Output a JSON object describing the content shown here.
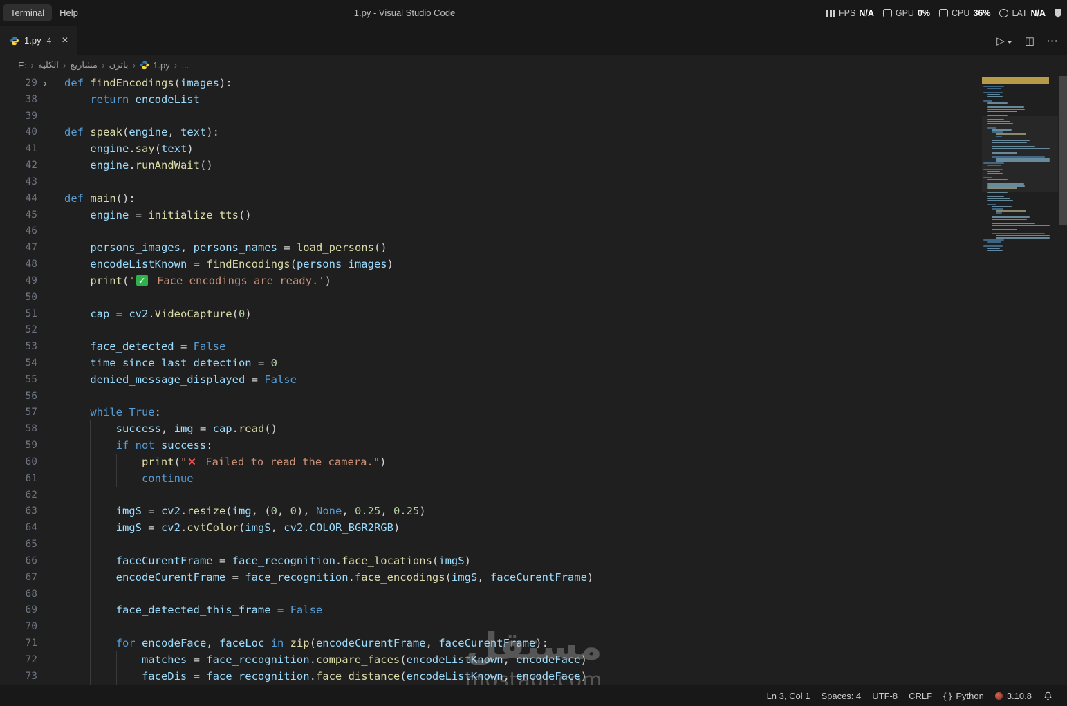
{
  "title_bar": {
    "menus": [
      {
        "label": "Terminal",
        "active": true
      },
      {
        "label": "Help",
        "active": false
      }
    ],
    "window_title": "1.py - Visual Studio Code",
    "perf_overlay": {
      "groups": [
        {
          "icon": "fps",
          "label": "FPS",
          "value": "N/A"
        },
        {
          "icon": "gpu",
          "label": "GPU",
          "value": "0%"
        },
        {
          "icon": "cpu",
          "label": "CPU",
          "value": "36%"
        },
        {
          "icon": "lat",
          "label": "LAT",
          "value": "N/A"
        }
      ]
    }
  },
  "tab_bar": {
    "tabs": [
      {
        "label": "1.py",
        "badge": "4"
      }
    ]
  },
  "breadcrumb": {
    "items": [
      {
        "label": "E:"
      },
      {
        "label": "الكليه"
      },
      {
        "label": "مشاريع"
      },
      {
        "label": "باترن"
      },
      {
        "label": "1.py",
        "icon": "python"
      },
      {
        "label": "..."
      }
    ]
  },
  "icons": {
    "close": "×",
    "chevron": "›",
    "fold_chevron": "›",
    "run": "▷",
    "split": "◫",
    "more": "···",
    "braces": "{ }"
  },
  "editor": {
    "token_colors": {
      "kw": "#569cd6",
      "fn": "#dcdcaa",
      "var": "#9cdcfe",
      "pn": "#d4d4d4",
      "op": "#d4d4d4",
      "str": "#ce9178",
      "num": "#b5cea8"
    },
    "lines": [
      {
        "n": 29,
        "ind": 0,
        "fold": true,
        "t": [
          [
            "kw",
            "def "
          ],
          [
            "fn",
            "findEncodings"
          ],
          [
            "pn",
            "("
          ],
          [
            "var",
            "images"
          ],
          [
            "pn",
            "):"
          ]
        ]
      },
      {
        "n": 38,
        "ind": 1,
        "t": [
          [
            "kw",
            "return "
          ],
          [
            "var",
            "encodeList"
          ]
        ]
      },
      {
        "n": 39,
        "ind": 0,
        "t": []
      },
      {
        "n": 40,
        "ind": 0,
        "t": [
          [
            "kw",
            "def "
          ],
          [
            "fn",
            "speak"
          ],
          [
            "pn",
            "("
          ],
          [
            "var",
            "engine"
          ],
          [
            "pn",
            ", "
          ],
          [
            "var",
            "text"
          ],
          [
            "pn",
            "):"
          ]
        ]
      },
      {
        "n": 41,
        "ind": 1,
        "t": [
          [
            "var",
            "engine"
          ],
          [
            "pn",
            "."
          ],
          [
            "fn",
            "say"
          ],
          [
            "pn",
            "("
          ],
          [
            "var",
            "text"
          ],
          [
            "pn",
            ")"
          ]
        ]
      },
      {
        "n": 42,
        "ind": 1,
        "t": [
          [
            "var",
            "engine"
          ],
          [
            "pn",
            "."
          ],
          [
            "fn",
            "runAndWait"
          ],
          [
            "pn",
            "()"
          ]
        ]
      },
      {
        "n": 43,
        "ind": 0,
        "t": []
      },
      {
        "n": 44,
        "ind": 0,
        "t": [
          [
            "kw",
            "def "
          ],
          [
            "fn",
            "main"
          ],
          [
            "pn",
            "():"
          ]
        ]
      },
      {
        "n": 45,
        "ind": 1,
        "t": [
          [
            "var",
            "engine"
          ],
          [
            "op",
            " = "
          ],
          [
            "fn",
            "initialize_tts"
          ],
          [
            "pn",
            "()"
          ]
        ]
      },
      {
        "n": 46,
        "ind": 1,
        "t": []
      },
      {
        "n": 47,
        "ind": 1,
        "t": [
          [
            "var",
            "persons_images"
          ],
          [
            "pn",
            ", "
          ],
          [
            "var",
            "persons_names"
          ],
          [
            "op",
            " = "
          ],
          [
            "fn",
            "load_persons"
          ],
          [
            "pn",
            "()"
          ]
        ]
      },
      {
        "n": 48,
        "ind": 1,
        "t": [
          [
            "var",
            "encodeListKnown"
          ],
          [
            "op",
            " = "
          ],
          [
            "fn",
            "findEncodings"
          ],
          [
            "pn",
            "("
          ],
          [
            "var",
            "persons_images"
          ],
          [
            "pn",
            ")"
          ]
        ]
      },
      {
        "n": 49,
        "ind": 1,
        "t": [
          [
            "fn",
            "print"
          ],
          [
            "pn",
            "("
          ],
          [
            "str",
            "'"
          ],
          [
            "chk",
            ""
          ],
          [
            "str",
            " Face encodings are ready.'"
          ],
          [
            "pn",
            ")"
          ]
        ]
      },
      {
        "n": 50,
        "ind": 1,
        "t": []
      },
      {
        "n": 51,
        "ind": 1,
        "t": [
          [
            "var",
            "cap"
          ],
          [
            "op",
            " = "
          ],
          [
            "var",
            "cv2"
          ],
          [
            "pn",
            "."
          ],
          [
            "fn",
            "VideoCapture"
          ],
          [
            "pn",
            "("
          ],
          [
            "num",
            "0"
          ],
          [
            "pn",
            ")"
          ]
        ]
      },
      {
        "n": 52,
        "ind": 1,
        "t": []
      },
      {
        "n": 53,
        "ind": 1,
        "t": [
          [
            "var",
            "face_detected"
          ],
          [
            "op",
            " = "
          ],
          [
            "kw",
            "False"
          ]
        ]
      },
      {
        "n": 54,
        "ind": 1,
        "t": [
          [
            "var",
            "time_since_last_detection"
          ],
          [
            "op",
            " = "
          ],
          [
            "num",
            "0"
          ]
        ]
      },
      {
        "n": 55,
        "ind": 1,
        "t": [
          [
            "var",
            "denied_message_displayed"
          ],
          [
            "op",
            " = "
          ],
          [
            "kw",
            "False"
          ]
        ]
      },
      {
        "n": 56,
        "ind": 1,
        "t": []
      },
      {
        "n": 57,
        "ind": 1,
        "t": [
          [
            "kw",
            "while "
          ],
          [
            "kw",
            "True"
          ],
          [
            "pn",
            ":"
          ]
        ]
      },
      {
        "n": 58,
        "ind": 2,
        "t": [
          [
            "var",
            "success"
          ],
          [
            "pn",
            ", "
          ],
          [
            "var",
            "img"
          ],
          [
            "op",
            " = "
          ],
          [
            "var",
            "cap"
          ],
          [
            "pn",
            "."
          ],
          [
            "fn",
            "read"
          ],
          [
            "pn",
            "()"
          ]
        ]
      },
      {
        "n": 59,
        "ind": 2,
        "t": [
          [
            "kw",
            "if "
          ],
          [
            "kw",
            "not "
          ],
          [
            "var",
            "success"
          ],
          [
            "pn",
            ":"
          ]
        ]
      },
      {
        "n": 60,
        "ind": 3,
        "t": [
          [
            "fn",
            "print"
          ],
          [
            "pn",
            "("
          ],
          [
            "str",
            "\""
          ],
          [
            "crs",
            ""
          ],
          [
            "str",
            " Failed to read the camera.\""
          ],
          [
            "pn",
            ")"
          ]
        ]
      },
      {
        "n": 61,
        "ind": 3,
        "t": [
          [
            "kw",
            "continue"
          ]
        ]
      },
      {
        "n": 62,
        "ind": 2,
        "t": []
      },
      {
        "n": 63,
        "ind": 2,
        "t": [
          [
            "var",
            "imgS"
          ],
          [
            "op",
            " = "
          ],
          [
            "var",
            "cv2"
          ],
          [
            "pn",
            "."
          ],
          [
            "fn",
            "resize"
          ],
          [
            "pn",
            "("
          ],
          [
            "var",
            "img"
          ],
          [
            "pn",
            ", ("
          ],
          [
            "num",
            "0"
          ],
          [
            "pn",
            ", "
          ],
          [
            "num",
            "0"
          ],
          [
            "pn",
            "), "
          ],
          [
            "kw",
            "None"
          ],
          [
            "pn",
            ", "
          ],
          [
            "num",
            "0.25"
          ],
          [
            "pn",
            ", "
          ],
          [
            "num",
            "0.25"
          ],
          [
            "pn",
            ")"
          ]
        ]
      },
      {
        "n": 64,
        "ind": 2,
        "t": [
          [
            "var",
            "imgS"
          ],
          [
            "op",
            " = "
          ],
          [
            "var",
            "cv2"
          ],
          [
            "pn",
            "."
          ],
          [
            "fn",
            "cvtColor"
          ],
          [
            "pn",
            "("
          ],
          [
            "var",
            "imgS"
          ],
          [
            "pn",
            ", "
          ],
          [
            "var",
            "cv2"
          ],
          [
            "pn",
            "."
          ],
          [
            "var",
            "COLOR_BGR2RGB"
          ],
          [
            "pn",
            ")"
          ]
        ]
      },
      {
        "n": 65,
        "ind": 2,
        "t": []
      },
      {
        "n": 66,
        "ind": 2,
        "t": [
          [
            "var",
            "faceCurentFrame"
          ],
          [
            "op",
            " = "
          ],
          [
            "var",
            "face_recognition"
          ],
          [
            "pn",
            "."
          ],
          [
            "fn",
            "face_locations"
          ],
          [
            "pn",
            "("
          ],
          [
            "var",
            "imgS"
          ],
          [
            "pn",
            ")"
          ]
        ]
      },
      {
        "n": 67,
        "ind": 2,
        "t": [
          [
            "var",
            "encodeCurentFrame"
          ],
          [
            "op",
            " = "
          ],
          [
            "var",
            "face_recognition"
          ],
          [
            "pn",
            "."
          ],
          [
            "fn",
            "face_encodings"
          ],
          [
            "pn",
            "("
          ],
          [
            "var",
            "imgS"
          ],
          [
            "pn",
            ", "
          ],
          [
            "var",
            "faceCurentFrame"
          ],
          [
            "pn",
            ")"
          ]
        ]
      },
      {
        "n": 68,
        "ind": 2,
        "t": []
      },
      {
        "n": 69,
        "ind": 2,
        "t": [
          [
            "var",
            "face_detected_this_frame"
          ],
          [
            "op",
            " = "
          ],
          [
            "kw",
            "False"
          ]
        ]
      },
      {
        "n": 70,
        "ind": 2,
        "t": []
      },
      {
        "n": 71,
        "ind": 2,
        "t": [
          [
            "kw",
            "for "
          ],
          [
            "var",
            "encodeFace"
          ],
          [
            "pn",
            ", "
          ],
          [
            "var",
            "faceLoc"
          ],
          [
            "kw",
            " in "
          ],
          [
            "fn",
            "zip"
          ],
          [
            "pn",
            "("
          ],
          [
            "var",
            "encodeCurentFrame"
          ],
          [
            "pn",
            ", "
          ],
          [
            "var",
            "faceCurentFrame"
          ],
          [
            "pn",
            "):"
          ]
        ]
      },
      {
        "n": 72,
        "ind": 3,
        "t": [
          [
            "var",
            "matches"
          ],
          [
            "op",
            " = "
          ],
          [
            "var",
            "face_recognition"
          ],
          [
            "pn",
            "."
          ],
          [
            "fn",
            "compare_faces"
          ],
          [
            "pn",
            "("
          ],
          [
            "var",
            "encodeListKnown"
          ],
          [
            "pn",
            ", "
          ],
          [
            "var",
            "encodeFace"
          ],
          [
            "pn",
            ")"
          ]
        ]
      },
      {
        "n": 73,
        "ind": 3,
        "t": [
          [
            "var",
            "faceDis"
          ],
          [
            "op",
            " = "
          ],
          [
            "var",
            "face_recognition"
          ],
          [
            "pn",
            "."
          ],
          [
            "fn",
            "face_distance"
          ],
          [
            "pn",
            "("
          ],
          [
            "var",
            "encodeListKnown"
          ],
          [
            "pn",
            ", "
          ],
          [
            "var",
            "encodeFace"
          ],
          [
            "pn",
            ")"
          ]
        ]
      }
    ]
  },
  "status_bar": {
    "items": [
      {
        "name": "cursor-position",
        "text": "Ln 3, Col 1"
      },
      {
        "name": "indentation",
        "text": "Spaces: 4"
      },
      {
        "name": "encoding",
        "text": "UTF-8"
      },
      {
        "name": "eol",
        "text": "CRLF"
      },
      {
        "name": "language-mode",
        "text": "Python",
        "icon": "braces"
      },
      {
        "name": "python-version",
        "text": "3.10.8",
        "icon": "env-dot"
      },
      {
        "name": "notifications",
        "text": "",
        "icon": "bell"
      }
    ]
  },
  "watermark": {
    "line1": "مستقل",
    "line2": "mostaql.com"
  }
}
